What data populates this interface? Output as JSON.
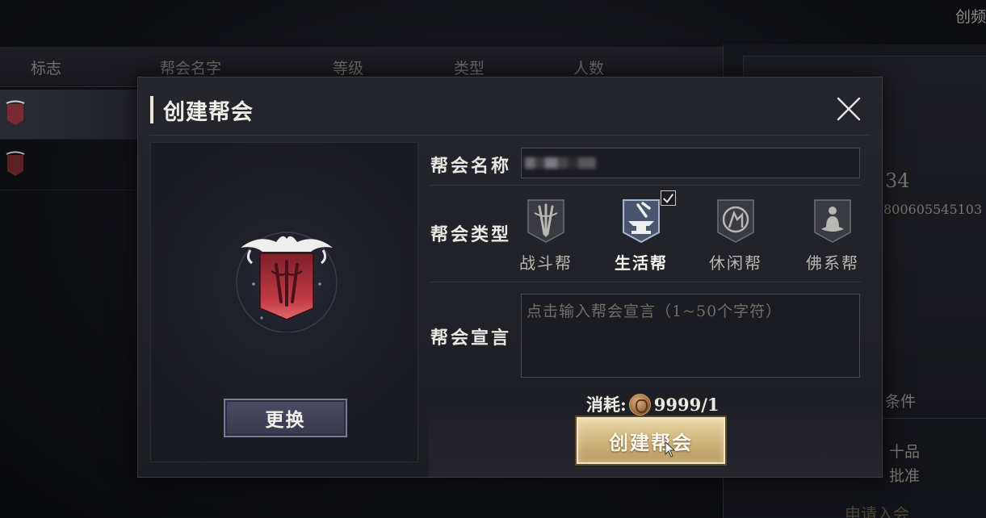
{
  "background": {
    "corner_text": "创频",
    "columns": [
      "标志",
      "帮会名字",
      "等级",
      "类型",
      "人数"
    ],
    "right_number": "34",
    "right_id": "800605545103",
    "right_condition": "条件",
    "right_grade": "十品",
    "right_approve": "批准",
    "right_apply": "申请入会"
  },
  "dialog": {
    "title": "创建帮会",
    "swap_label": "更换",
    "name_label": "帮会名称",
    "name_value": "",
    "type_label": "帮会类型",
    "types": [
      {
        "label": "战斗帮",
        "icon": "swords-icon",
        "selected": false
      },
      {
        "label": "生活帮",
        "icon": "anvil-icon",
        "selected": true
      },
      {
        "label": "休闲帮",
        "icon": "leisure-icon",
        "selected": false
      },
      {
        "label": "佛系帮",
        "icon": "meditation-icon",
        "selected": false
      }
    ],
    "declaration_label": "帮会宣言",
    "declaration_placeholder": "点击输入帮会宣言（1~50个字符）",
    "cost_label": "消耗:",
    "cost_value": "9999/1",
    "create_label": "创建帮会"
  },
  "colors": {
    "gold_button": "#cdb27a",
    "swap_button": "#44455c",
    "emblem_red": "#b2303c"
  }
}
